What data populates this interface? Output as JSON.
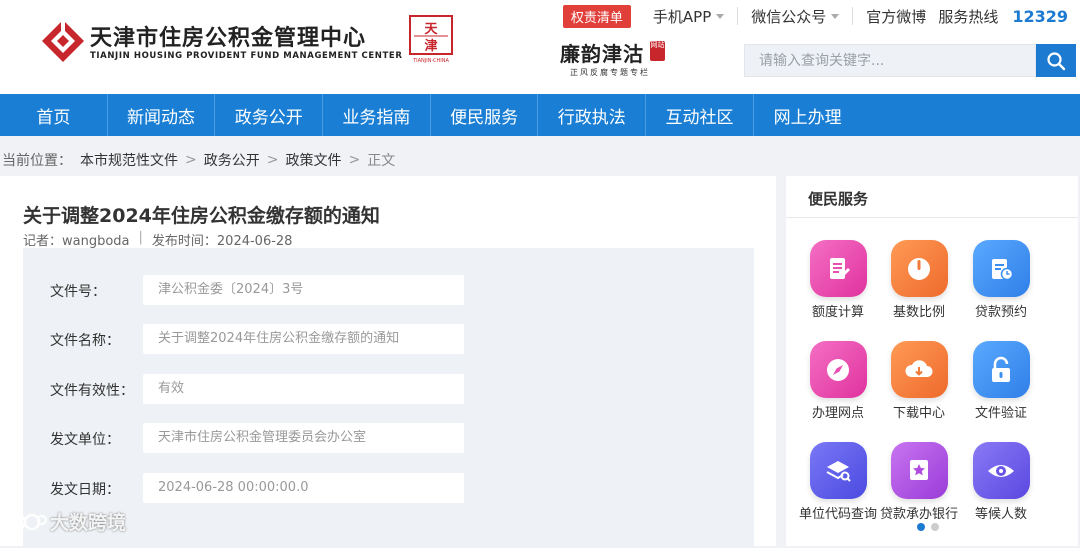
{
  "header": {
    "logo_cn": "天津市住房公积金管理中心",
    "logo_en": "TIANJIN HOUSING PROVIDENT FUND MANAGEMENT CENTER",
    "seal_caption": "TIANJIN·CHINA",
    "topbar": {
      "badge": "权责清单",
      "app": "手机APP",
      "wechat": "微信公众号",
      "weibo": "官方微博",
      "hotline_label": "服务热线",
      "hotline_number": "12329"
    },
    "column_logo": {
      "title": "廉韵津沽",
      "stamp": "网站",
      "subtitle": "正风反腐专题专栏"
    },
    "search": {
      "placeholder": "请输入查询关键字..."
    }
  },
  "nav": [
    {
      "label": "首页"
    },
    {
      "label": "新闻动态"
    },
    {
      "label": "政务公开"
    },
    {
      "label": "业务指南"
    },
    {
      "label": "便民服务"
    },
    {
      "label": "行政执法"
    },
    {
      "label": "互动社区"
    },
    {
      "label": "网上办理"
    }
  ],
  "breadcrumb": {
    "prefix": "当前位置：",
    "items": [
      "本市规范性文件",
      "政务公开",
      "政策文件"
    ],
    "current": "正文"
  },
  "article": {
    "title": "关于调整2024年住房公积金缴存额的通知",
    "reporter": "记者：wangboda",
    "published": "发布时间：2024-06-28",
    "fields": [
      {
        "label": "文件号：",
        "value": "津公积金委〔2024〕3号"
      },
      {
        "label": "文件名称：",
        "value": "关于调整2024年住房公积金缴存额的通知"
      },
      {
        "label": "文件有效性：",
        "value": "有效"
      },
      {
        "label": "发文单位：",
        "value": "天津市住房公积金管理委员会办公室"
      },
      {
        "label": "发文日期：",
        "value": "2024-06-28 00:00:00.0"
      }
    ]
  },
  "side": {
    "title": "便民服务",
    "services": [
      {
        "label": "额度计算",
        "icon": "document-edit-icon",
        "color": "#e84fb0"
      },
      {
        "label": "基数比例",
        "icon": "power-icon",
        "color": "#f07a3a"
      },
      {
        "label": "贷款预约",
        "icon": "calendar-doc-icon",
        "color": "#3b8ff0"
      },
      {
        "label": "办理网点",
        "icon": "compass-icon",
        "color": "#e84fb0"
      },
      {
        "label": "下载中心",
        "icon": "cloud-download-icon",
        "color": "#f07a3a"
      },
      {
        "label": "文件验证",
        "icon": "lock-icon",
        "color": "#3b8ff0"
      },
      {
        "label": "单位代码查询",
        "icon": "layers-search-icon",
        "color": "#5b5be8"
      },
      {
        "label": "贷款承办银行",
        "icon": "star-badge-icon",
        "color": "#b04be0"
      },
      {
        "label": "等候人数",
        "icon": "eye-icon",
        "color": "#6a55e8"
      }
    ]
  },
  "watermark": "大数跨境",
  "colors": {
    "primary": "#1a7fd4",
    "badge": "#e1403a",
    "brand_red": "#c8262d"
  }
}
